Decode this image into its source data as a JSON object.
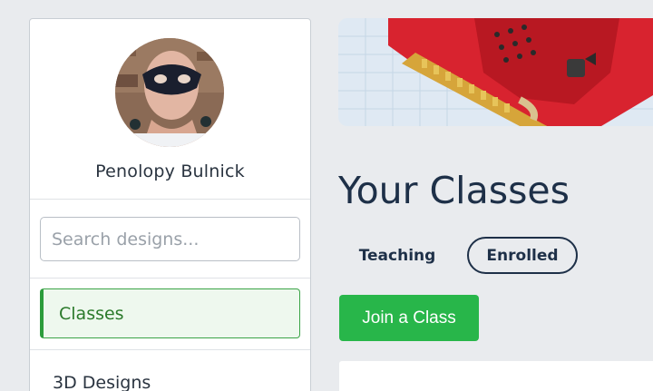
{
  "profile": {
    "name": "Penolopy Bulnick"
  },
  "search": {
    "placeholder": "Search designs..."
  },
  "nav": {
    "active_label": "Classes",
    "items": [
      "3D Designs"
    ]
  },
  "main": {
    "title": "Your Classes",
    "tabs": [
      {
        "label": "Teaching",
        "selected": false
      },
      {
        "label": "Enrolled",
        "selected": true
      }
    ],
    "join_button": "Join a Class"
  },
  "colors": {
    "accent_green": "#28b64a",
    "active_nav_border": "#2b9c3b",
    "title_navy": "#1e3048",
    "background": "#e9ebee"
  },
  "icons": {
    "avatar": "user-avatar-photo",
    "banner": "microbit-3d-model"
  }
}
